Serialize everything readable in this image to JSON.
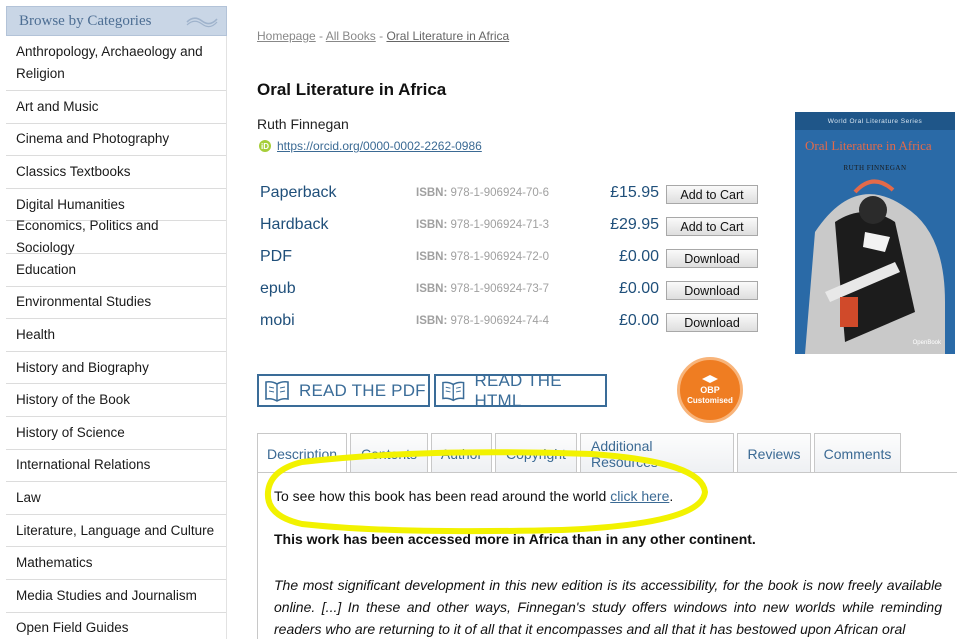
{
  "sidebar": {
    "header": "Browse by Categories",
    "items": [
      "Anthropology, Archaeology and Religion",
      "Art and Music",
      "Cinema and Photography",
      "Classics Textbooks",
      "Digital Humanities",
      "Economics, Politics and Sociology",
      "Education",
      "Environmental Studies",
      "Health",
      "History and Biography",
      "History of the Book",
      "History of Science",
      "International Relations",
      "Law",
      "Literature, Language and Culture",
      "Mathematics",
      "Media Studies and Journalism",
      "Open Field Guides"
    ]
  },
  "breadcrumb": {
    "home": "Homepage",
    "all": "All Books",
    "current": "Oral Literature in Africa",
    "sep": " - "
  },
  "book": {
    "title": "Oral Literature in Africa",
    "author": "Ruth Finnegan",
    "orcid_badge": "iD",
    "orcid": "https://orcid.org/0000-0002-2262-0986"
  },
  "formats": [
    {
      "name": "Paperback",
      "isbn_label": "ISBN:",
      "isbn": "978-1-906924-70-6",
      "price": "£15.95",
      "action": "Add to Cart"
    },
    {
      "name": "Hardback",
      "isbn_label": "ISBN:",
      "isbn": "978-1-906924-71-3",
      "price": "£29.95",
      "action": "Add to Cart"
    },
    {
      "name": "PDF",
      "isbn_label": "ISBN:",
      "isbn": "978-1-906924-72-0",
      "price": "£0.00",
      "action": "Download"
    },
    {
      "name": "epub",
      "isbn_label": "ISBN:",
      "isbn": "978-1-906924-73-7",
      "price": "£0.00",
      "action": "Download"
    },
    {
      "name": "mobi",
      "isbn_label": "ISBN:",
      "isbn": "978-1-906924-74-4",
      "price": "£0.00",
      "action": "Download"
    }
  ],
  "cover": {
    "series": "World Oral Literature Series",
    "title": "Oral Literature in Africa",
    "author": "RUTH FINNEGAN",
    "publisher": "OpenBook"
  },
  "read": {
    "pdf": "READ THE PDF",
    "html": "READ THE HTML"
  },
  "obp_badge": {
    "line1": "OBP",
    "line2": "Customised"
  },
  "tabs": [
    "Description",
    "Contents",
    "Author",
    "Copyright",
    "Additional Resources",
    "Reviews",
    "Comments"
  ],
  "description": {
    "line1_text": "To see how this book has been read around the world ",
    "line1_link": "click here",
    "line1_end": ".",
    "line2": "This work has been accessed more in Africa than in any other continent.",
    "para": "The most significant development in this new edition is its accessibility, for the book is now freely available online. [...] In these and other ways,  Finnegan's study offers windows into new worlds while reminding readers who are returning to it of all that it encompasses and all that it has bestowed upon African oral"
  },
  "colors": {
    "link": "#3b6a94",
    "price": "#1f4f7a",
    "highlight": "#f2f200",
    "badge": "#ef7d22"
  }
}
